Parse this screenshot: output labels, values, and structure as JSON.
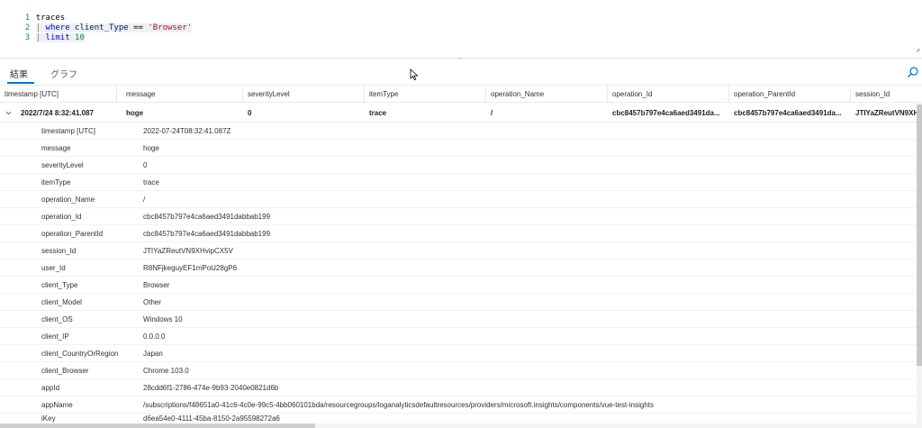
{
  "editor": {
    "lines": [
      {
        "num": "1",
        "text": "traces"
      },
      {
        "num": "2",
        "pipe": "|",
        "kw": "where",
        "field": "client_Type",
        "op": "==",
        "str": "'Browser'"
      },
      {
        "num": "3",
        "pipe": "|",
        "kw": "limit",
        "value": "10"
      }
    ],
    "splitter_dots": "...",
    "edge_glyph": "↗"
  },
  "tabs": [
    {
      "label": "結果",
      "active": true
    },
    {
      "label": "グラフ",
      "active": false
    }
  ],
  "columns": [
    "timestamp [UTC]",
    "message",
    "severityLevel",
    "itemType",
    "operation_Name",
    "operation_Id",
    "operation_ParentId",
    "session_Id"
  ],
  "main_row": {
    "timestamp": "2022/7/24 8:32:41.087",
    "message": "hoge",
    "severityLevel": "0",
    "itemType": "trace",
    "operation_Name": "/",
    "operation_Id": "cbc8457b797e4ca6aed3491da...",
    "operation_ParentId": "cbc8457b797e4ca6aed3491da...",
    "session_Id": "JTIYaZReutVN9XH..."
  },
  "details": [
    {
      "key": "timestamp [UTC]",
      "value": "2022-07-24T08:32:41.087Z"
    },
    {
      "key": "message",
      "value": "hoge"
    },
    {
      "key": "severityLevel",
      "value": "0"
    },
    {
      "key": "itemType",
      "value": "trace"
    },
    {
      "key": "operation_Name",
      "value": "/"
    },
    {
      "key": "operation_Id",
      "value": "cbc8457b797e4ca6aed3491dabbab199"
    },
    {
      "key": "operation_ParentId",
      "value": "cbc8457b797e4ca6aed3491dabbab199"
    },
    {
      "key": "session_Id",
      "value": "JTIYaZReutVN9XHvipCX5V"
    },
    {
      "key": "user_Id",
      "value": "R8NFjkeguyEF1mPoU28gP6"
    },
    {
      "key": "client_Type",
      "value": "Browser"
    },
    {
      "key": "client_Model",
      "value": "Other"
    },
    {
      "key": "client_OS",
      "value": "Windows 10"
    },
    {
      "key": "client_IP",
      "value": "0.0.0.0"
    },
    {
      "key": "client_CountryOrRegion",
      "value": "Japan"
    },
    {
      "key": "client_Browser",
      "value": "Chrome 103.0"
    },
    {
      "key": "appId",
      "value": "28cdd6f1-2786-474e-9b93-2040e0821d6b"
    },
    {
      "key": "appName",
      "value": "/subscriptions/f48651a0-41c6-4c0e-99c5-4bb060101bda/resourcegroups/loganalyticsdefaultresources/providers/microsoft.insights/components/vue-test-insights"
    },
    {
      "key": "iKey",
      "value": "d6ea54e0-4111-45ba-8150-2a95598272a6"
    }
  ],
  "colors": {
    "accent": "#0078d4",
    "keyword": "#0000ff",
    "string": "#a31515",
    "number": "#098658",
    "line_number": "#237893"
  },
  "icons": [
    "chevron-down-icon",
    "search-icon",
    "mouse-pointer-icon",
    "pop-out-icon"
  ]
}
